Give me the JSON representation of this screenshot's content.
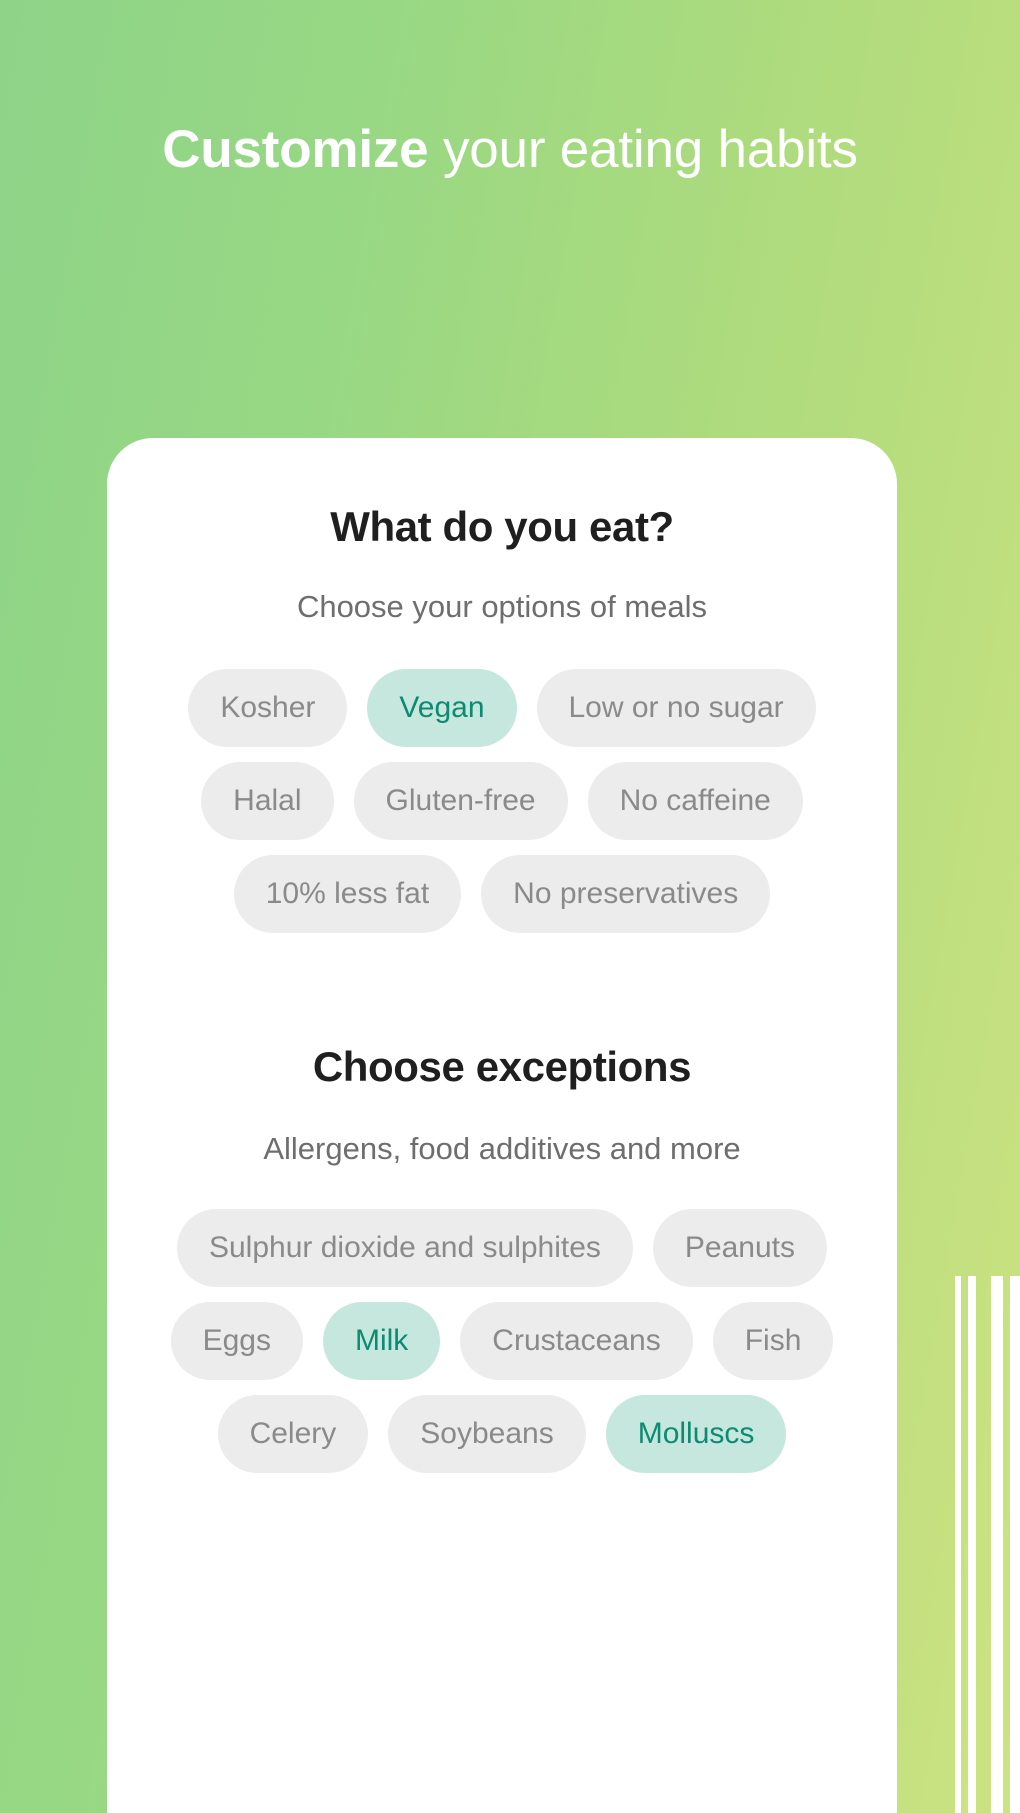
{
  "headline": {
    "strong": "Customize",
    "rest": " your eating habits"
  },
  "card": {
    "eat_section": {
      "title": "What do you eat?",
      "subtitle": "Choose your options of meals",
      "options": [
        {
          "label": "Kosher",
          "selected": false
        },
        {
          "label": "Vegan",
          "selected": true
        },
        {
          "label": "Low or no sugar",
          "selected": false
        },
        {
          "label": "Halal",
          "selected": false
        },
        {
          "label": "Gluten-free",
          "selected": false
        },
        {
          "label": "No caffeine",
          "selected": false
        },
        {
          "label": "10% less fat",
          "selected": false
        },
        {
          "label": "No preservatives",
          "selected": false
        }
      ]
    },
    "exceptions_section": {
      "title": "Choose exceptions",
      "subtitle": "Allergens, food additives and more",
      "options": [
        {
          "label": "Sulphur dioxide and sulphites",
          "selected": false
        },
        {
          "label": "Peanuts",
          "selected": false
        },
        {
          "label": "Eggs",
          "selected": false
        },
        {
          "label": "Milk",
          "selected": true
        },
        {
          "label": "Crustaceans",
          "selected": false
        },
        {
          "label": "Fish",
          "selected": false
        },
        {
          "label": "Celery",
          "selected": false
        },
        {
          "label": "Soybeans",
          "selected": false
        },
        {
          "label": "Molluscs",
          "selected": true
        }
      ]
    }
  },
  "colors": {
    "background_green_left": "#8ed388",
    "background_green_right": "#cde382",
    "card_background": "#ffffff",
    "chip_background": "#ececed",
    "chip_text": "#8a8a8a",
    "chip_selected_background": "#c6e7de",
    "chip_selected_text": "#0d8a72",
    "heading_text": "#1f1f1f",
    "subtitle_text": "#6e6e6e",
    "headline_text": "#ffffff",
    "stripe": "#ffffff"
  }
}
